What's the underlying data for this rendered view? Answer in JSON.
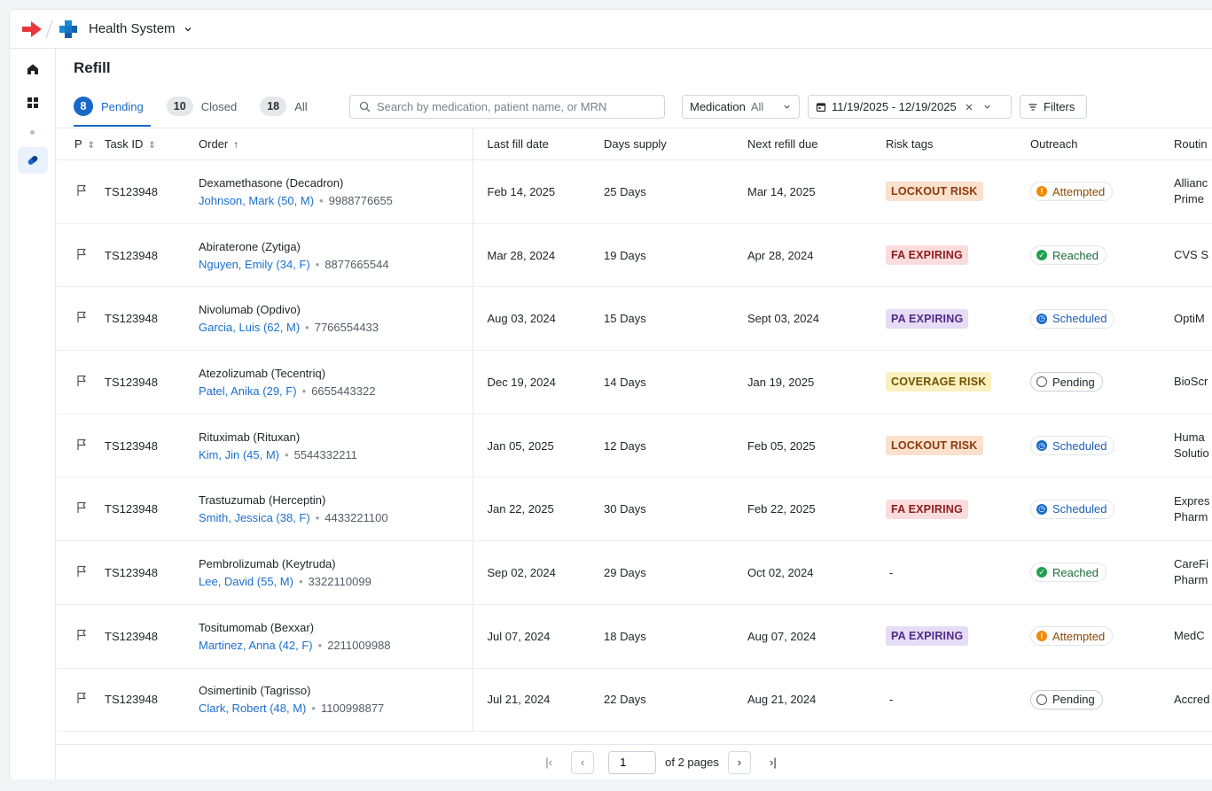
{
  "header": {
    "org_name": "Health System"
  },
  "page": {
    "title": "Refill"
  },
  "tabs": [
    {
      "count": "8",
      "label": "Pending"
    },
    {
      "count": "10",
      "label": "Closed"
    },
    {
      "count": "18",
      "label": "All"
    }
  ],
  "search": {
    "placeholder": "Search by medication, patient name, or MRN"
  },
  "filters": {
    "medication_label": "Medication",
    "medication_value": "All",
    "date_range": "11/19/2025 - 12/19/2025",
    "filters_label": "Filters"
  },
  "columns": {
    "p": "P",
    "task_id": "Task ID",
    "order": "Order",
    "last_fill": "Last fill date",
    "days_supply": "Days supply",
    "next_refill": "Next refill due",
    "risk_tags": "Risk tags",
    "outreach": "Outreach",
    "routing": "Routin"
  },
  "rows": [
    {
      "task_id": "TS123948",
      "med": "Dexamethasone (Decadron)",
      "patient": "Johnson, Mark (50, M)",
      "mrn": "9988776655",
      "last_fill": "Feb 14, 2025",
      "days": "25 Days",
      "next": "Mar 14, 2025",
      "risk": "LOCKOUT RISK",
      "outreach": "Attempted",
      "route1": "Allianc",
      "route2": "Prime"
    },
    {
      "task_id": "TS123948",
      "med": "Abiraterone (Zytiga)",
      "patient": "Nguyen, Emily (34, F)",
      "mrn": "8877665544",
      "last_fill": "Mar 28, 2024",
      "days": "19 Days",
      "next": "Apr 28, 2024",
      "risk": "FA EXPIRING",
      "outreach": "Reached",
      "route1": "CVS S",
      "route2": ""
    },
    {
      "task_id": "TS123948",
      "med": "Nivolumab (Opdivo)",
      "patient": "Garcia, Luis (62, M)",
      "mrn": "7766554433",
      "last_fill": "Aug 03, 2024",
      "days": "15 Days",
      "next": "Sept 03, 2024",
      "risk": "PA EXPIRING",
      "outreach": "Scheduled",
      "route1": "OptiM",
      "route2": ""
    },
    {
      "task_id": "TS123948",
      "med": "Atezolizumab (Tecentriq)",
      "patient": "Patel, Anika (29, F)",
      "mrn": "6655443322",
      "last_fill": "Dec 19, 2024",
      "days": "14 Days",
      "next": "Jan 19, 2025",
      "risk": "COVERAGE RISK",
      "outreach": "Pending",
      "route1": "BioScr",
      "route2": ""
    },
    {
      "task_id": "TS123948",
      "med": "Rituximab (Rituxan)",
      "patient": "Kim, Jin (45, M)",
      "mrn": "5544332211",
      "last_fill": "Jan 05, 2025",
      "days": "12 Days",
      "next": "Feb 05, 2025",
      "risk": "LOCKOUT RISK",
      "outreach": "Scheduled",
      "route1": "Huma",
      "route2": "Solutio"
    },
    {
      "task_id": "TS123948",
      "med": "Trastuzumab (Herceptin)",
      "patient": "Smith, Jessica (38, F)",
      "mrn": "4433221100",
      "last_fill": "Jan 22, 2025",
      "days": "30 Days",
      "next": "Feb 22, 2025",
      "risk": "FA EXPIRING",
      "outreach": "Scheduled",
      "route1": "Expres",
      "route2": "Pharm"
    },
    {
      "task_id": "TS123948",
      "med": "Pembrolizumab (Keytruda)",
      "patient": "Lee, David (55, M)",
      "mrn": "3322110099",
      "last_fill": "Sep 02, 2024",
      "days": "29 Days",
      "next": "Oct 02, 2024",
      "risk": "-",
      "outreach": "Reached",
      "route1": "CareFi",
      "route2": "Pharm"
    },
    {
      "task_id": "TS123948",
      "med": "Tositumomab (Bexxar)",
      "patient": "Martinez, Anna (42, F)",
      "mrn": "2211009988",
      "last_fill": "Jul 07, 2024",
      "days": "18 Days",
      "next": "Aug 07, 2024",
      "risk": "PA EXPIRING",
      "outreach": "Attempted",
      "route1": "MedC",
      "route2": ""
    },
    {
      "task_id": "TS123948",
      "med": "Osimertinib (Tagrisso)",
      "patient": "Clark, Robert (48, M)",
      "mrn": "1100998877",
      "last_fill": "Jul 21, 2024",
      "days": "22 Days",
      "next": "Aug 21, 2024",
      "risk": "-",
      "outreach": "Pending",
      "route1": "Accred",
      "route2": ""
    }
  ],
  "pagination": {
    "current_page": "1",
    "of_pages": "of 2 pages"
  },
  "colors": {
    "accent": "#1668c9",
    "brand_red": "#e8383d",
    "brand_blue": "#1b6fcd"
  }
}
